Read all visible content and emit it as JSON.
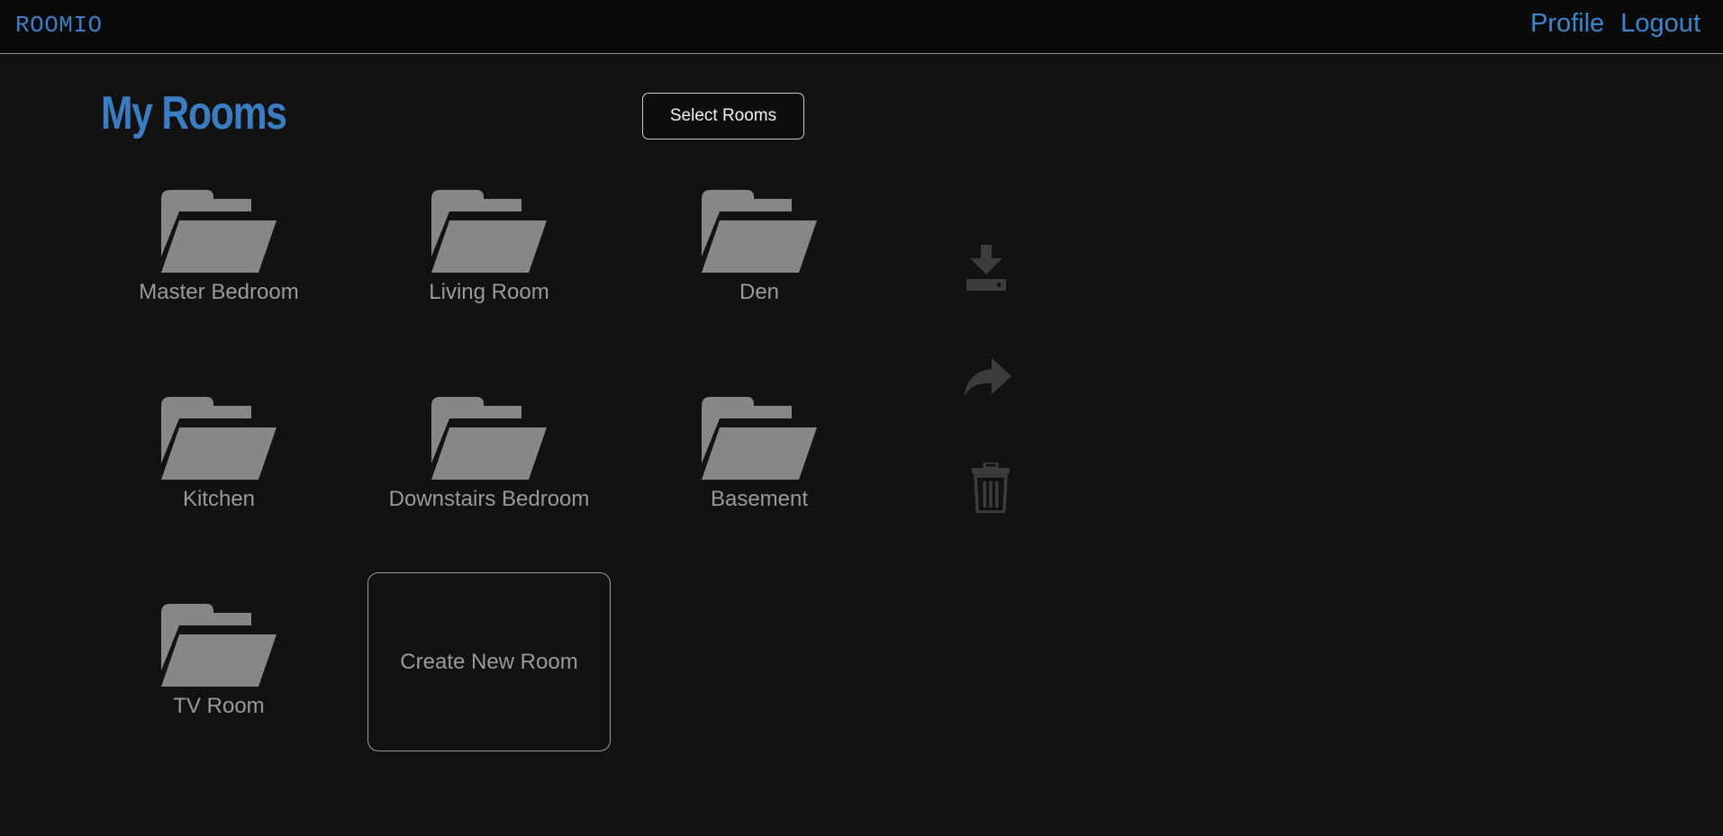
{
  "header": {
    "brand": "ROOMIO",
    "nav": {
      "profile": "Profile",
      "logout": "Logout"
    }
  },
  "main": {
    "title": "My Rooms",
    "select_button": "Select Rooms",
    "rooms": [
      {
        "label": "Master Bedroom",
        "icon": "folder-open-icon"
      },
      {
        "label": "Living Room",
        "icon": "folder-open-icon"
      },
      {
        "label": "Den",
        "icon": "folder-open-icon"
      },
      {
        "label": "Kitchen",
        "icon": "folder-open-icon"
      },
      {
        "label": "Downstairs Bedroom",
        "icon": "folder-open-icon"
      },
      {
        "label": "Basement",
        "icon": "folder-open-icon"
      },
      {
        "label": "TV Room",
        "icon": "folder-open-icon"
      }
    ],
    "create_room_label": "Create New Room"
  },
  "actions": [
    {
      "icon": "download-icon",
      "state": "disabled"
    },
    {
      "icon": "share-icon",
      "state": "disabled"
    },
    {
      "icon": "trash-icon",
      "state": "disabled"
    }
  ],
  "colors": {
    "background": "#121212",
    "topbar": "#0a0a0a",
    "accent": "#3b86d0",
    "folder": "#878787",
    "disabled_icon": "#3c3c3c"
  }
}
